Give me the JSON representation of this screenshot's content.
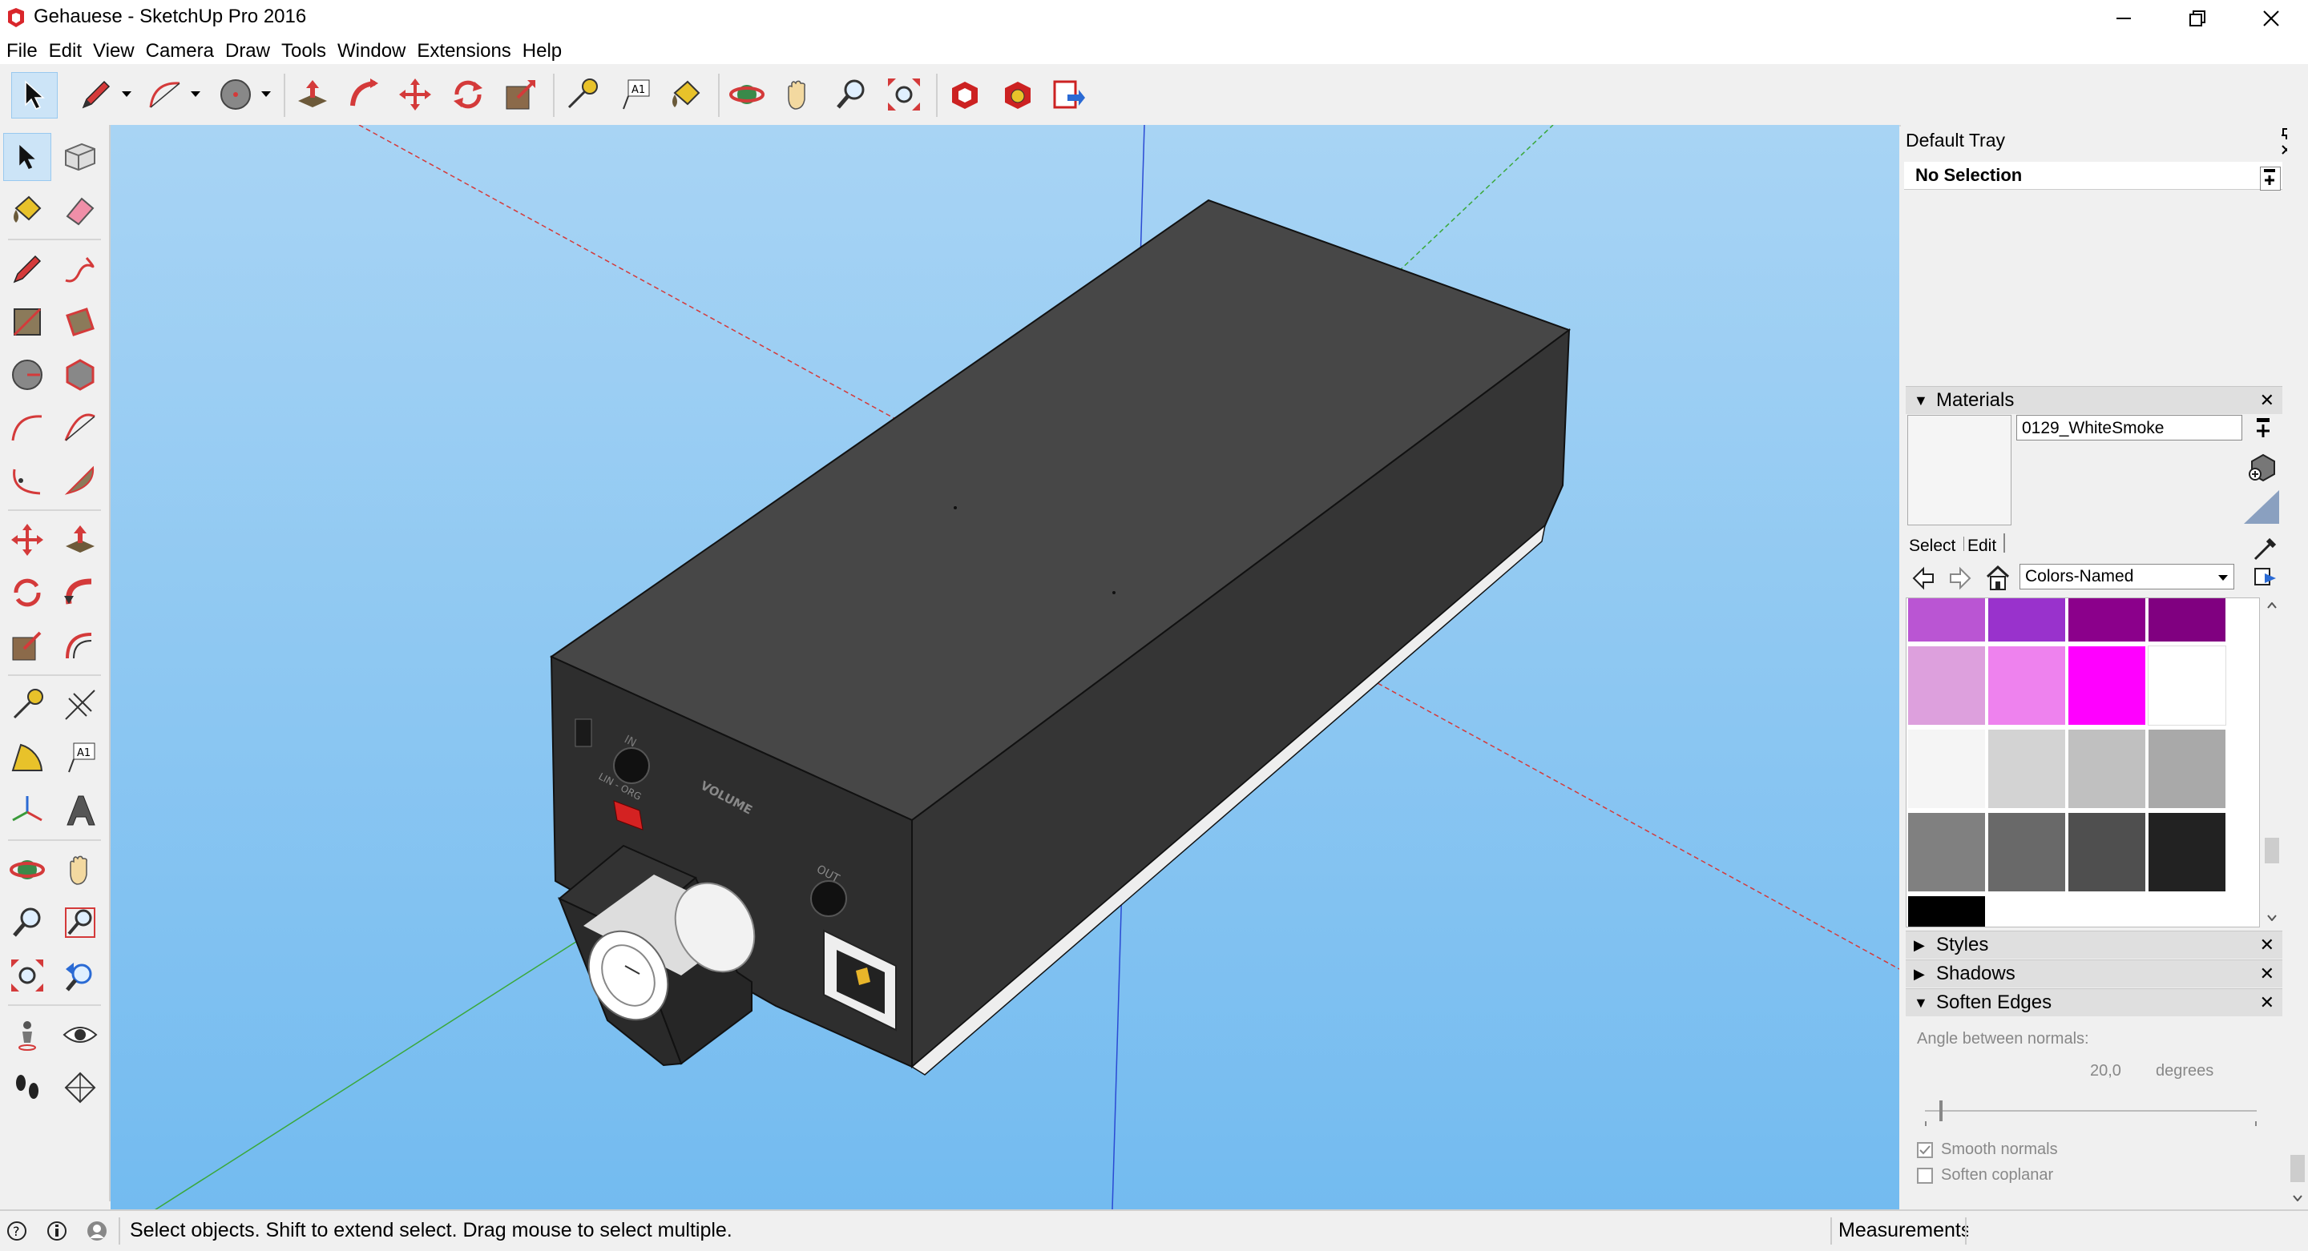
{
  "window": {
    "title": "Gehauese - SketchUp Pro 2016"
  },
  "menu": [
    "File",
    "Edit",
    "View",
    "Camera",
    "Draw",
    "Tools",
    "Window",
    "Extensions",
    "Help"
  ],
  "toolbar": {
    "tools": [
      "select-icon",
      "pencil-icon",
      "arc-icon",
      "circle-icon",
      "push-pull-icon",
      "follow-me-icon",
      "move-icon",
      "rotate-icon",
      "scale-icon",
      "tape-measure-icon",
      "text-icon",
      "paint-bucket-icon",
      "orbit-icon",
      "pan-icon",
      "zoom-icon",
      "zoom-extents-icon",
      "warehouse-icon",
      "extension-warehouse-icon",
      "send-to-layout-icon"
    ],
    "text_tool_glyph": "A1"
  },
  "left_toolbar": {
    "text_tool_glyph": "A1"
  },
  "model": {
    "labels": {
      "in": "IN",
      "volume": "VOLUME",
      "out": "OUT",
      "switch": "LIN - ORG"
    }
  },
  "tray": {
    "title": "Default Tray",
    "entity_info": {
      "selection": "No Selection"
    },
    "materials": {
      "header": "Materials",
      "material_name": "0129_WhiteSmoke",
      "tab_select": "Select",
      "tab_edit": "Edit",
      "library": "Colors-Named",
      "swatches": [
        [
          "#ba55d3",
          "#9932cc",
          "#8b008b",
          "#800080"
        ],
        [
          "#dda0dd",
          "#ee82ee",
          "#ff00ff",
          "#ffffff"
        ],
        [
          "#f5f5f5",
          "#d3d3d3",
          "#c0c0c0",
          "#a9a9a9"
        ],
        [
          "#808080",
          "#696969",
          "#4f4f4f",
          "#222222"
        ],
        [
          "#000000"
        ]
      ]
    },
    "styles": {
      "header": "Styles"
    },
    "shadows": {
      "header": "Shadows"
    },
    "soften_edges": {
      "header": "Soften Edges",
      "angle_label": "Angle between normals:",
      "angle_value": "20,0",
      "angle_unit": "degrees",
      "slider_value": 0.18,
      "smooth_normals_label": "Smooth normals",
      "smooth_normals_checked": true,
      "soften_coplanar_label": "Soften coplanar",
      "soften_coplanar_checked": false
    }
  },
  "status": {
    "message": "Select objects. Shift to extend select. Drag mouse to select multiple.",
    "measurements_label": "Measurements"
  }
}
